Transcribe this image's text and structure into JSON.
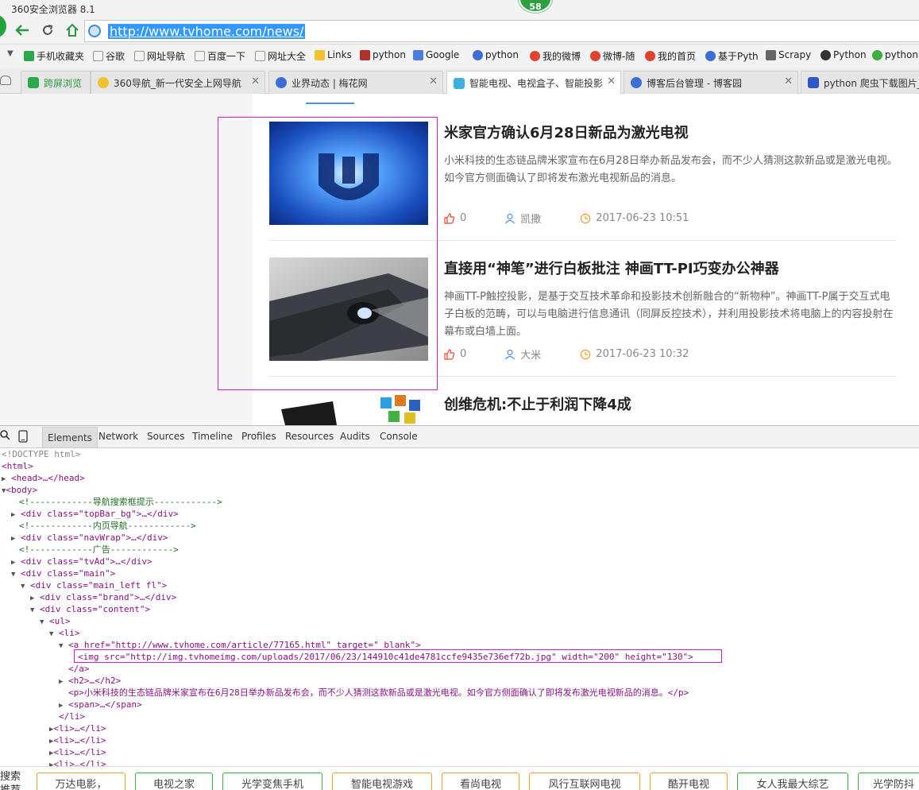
{
  "window": {
    "title": "360安全浏览器 8.1",
    "badge": "58"
  },
  "address": {
    "url": "http://www.tvhome.com/news/"
  },
  "bookmarks": [
    "手机收藏夹",
    "谷歌",
    "网址导航",
    "百度一下",
    "网址大全",
    "Links",
    "python",
    "Google",
    "python",
    "我的微博",
    "微博-随",
    "我的首页",
    "基于Pyth",
    "Scrapy",
    "Python",
    "python"
  ],
  "tabs": [
    {
      "label": "跨屏浏览"
    },
    {
      "label": "360导航_新一代安全上网导航"
    },
    {
      "label": "业界动态 | 梅花网"
    },
    {
      "label": "智能电视、电视盒子、智能投影"
    },
    {
      "label": "博客后台管理 - 博客园"
    },
    {
      "label": "python 爬虫下载图片_"
    }
  ],
  "articles": [
    {
      "title": "米家官方确认6月28日新品为激光电视",
      "summary": "小米科技的生态链品牌米家宣布在6月28日举办新品发布会，而不少人猜测这款新品或是激光电视。如今官方侧面确认了即将发布激光电视新品的消息。",
      "likes": "0",
      "author": "凯撒",
      "date": "2017-06-23 10:51"
    },
    {
      "title": "直接用“神笔”进行白板批注 神画TT-PI巧变办公神器",
      "summary": "神画TT-P触控投影，是基于交互技术革命和投影技术创新融合的“新物种”。神画TT-P属于交互式电子白板的范畴，可以与电脑进行信息通讯（同屏反控技术），并利用投影技术将电脑上的内容投射在幕布或白墙上面。",
      "likes": "0",
      "author": "大米",
      "date": "2017-06-23 10:32"
    },
    {
      "title": "创维危机:不止于利润下降4成"
    }
  ],
  "devtools": {
    "tabs": [
      "Elements",
      "Network",
      "Sources",
      "Timeline",
      "Profiles",
      "Resources",
      "Audits",
      "Console"
    ],
    "dom": {
      "doctype": "<!DOCTYPE html>",
      "html": "<html>",
      "head": "<head>…</head>",
      "body": "<body>",
      "c1": "<!------------导航搜索框提示------------>",
      "topbar": "<div class=\"topBar_bg\">…</div>",
      "c2": "<!------------内页导航------------>",
      "navwrap": "<div class=\"navWrap\">…</div>",
      "c3": "<!------------广告------------>",
      "tvad": "<div class=\"tvAd\">…</div>",
      "main": "<div class=\"main\">",
      "mainleft": "<div class=\"main_left fl\">",
      "brand": "<div class=\"brand\">…</div>",
      "content": "<div class=\"content\">",
      "ul": "<ul>",
      "li": "<li>",
      "a": "<a href=\"http://www.tvhome.com/article/77165.html\" target=\"_blank\">",
      "img": "<img src=\"http://img.tvhomeimg.com/uploads/2017/06/23/144910c41de4781ccfe9435e736ef72b.jpg\" width=\"200\" height=\"130\">",
      "aclose": "</a>",
      "h2": "<h2>…</h2>",
      "p": "<p>小米科技的生态链品牌米家宣布在6月28日举办新品发布会，而不少人猜测这款新品或是激光电视。如今官方侧面确认了即将发布激光电视新品的消息。</p>",
      "span": "<span>…</span>",
      "liclose": "</li>",
      "li2": "<li>…</li>",
      "li3": "<li>…</li>",
      "li4": "<li>…</li>",
      "li5": "<li>…</li>"
    }
  },
  "bottom": {
    "search": "搜索",
    "search2": "推荐",
    "items": [
      "万达电影，",
      "电视之家",
      "光学变焦手机",
      "智能电视游戏",
      "看尚电视",
      "风行互联网电视",
      "酷开电视",
      "女人我最大综艺",
      "光学防抖"
    ]
  },
  "colors": {
    "accent": "#4a90e2",
    "highlight": "#d21ad2",
    "brand_green": "#23a33a",
    "like_red": "#e8442e",
    "author_blue": "#4a90e2",
    "date_orange": "#f0a030"
  }
}
